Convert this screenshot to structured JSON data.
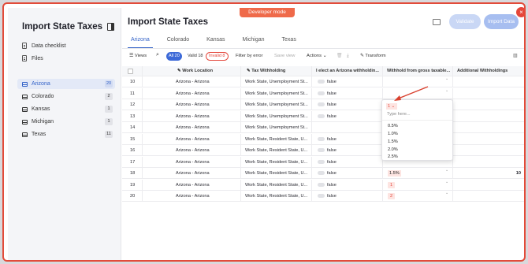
{
  "app": {
    "dev_banner": "Developer mode"
  },
  "sidebar": {
    "title": "Import State Taxes",
    "links": [
      "Data checklist",
      "Files"
    ],
    "sheets": [
      {
        "label": "Arizona",
        "count": "20",
        "active": true
      },
      {
        "label": "Colorado",
        "count": "2"
      },
      {
        "label": "Kansas",
        "count": "1"
      },
      {
        "label": "Michigan",
        "count": "1"
      },
      {
        "label": "Texas",
        "count": "11"
      }
    ]
  },
  "header": {
    "title": "Import State Taxes",
    "validate_label": "Validate",
    "import_label": "Import Data"
  },
  "tabs": [
    "Arizona",
    "Colorado",
    "Kansas",
    "Michigan",
    "Texas"
  ],
  "toolbar": {
    "views_label": "Views",
    "filter_all": "All 20",
    "filter_valid": "Valid 18",
    "filter_invalid": "Invalid 8",
    "filter_by_error": "Filter by error",
    "save_view": "Save view",
    "actions": "Actions",
    "transform": "Transform"
  },
  "table": {
    "columns": [
      "Work Location",
      "Tax Withholding",
      "I elect an Arizona withholdin...",
      "Withhold from gross taxable...",
      "Additional Withholdings"
    ],
    "rows": [
      {
        "n": "10",
        "loc": "Arizona - Arizona",
        "tax": "Work State, Unemployment St...",
        "elect": "false",
        "gross": "",
        "add": ""
      },
      {
        "n": "11",
        "loc": "Arizona - Arizona",
        "tax": "Work State, Unemployment St...",
        "elect": "false",
        "gross": "",
        "add": ""
      },
      {
        "n": "12",
        "loc": "Arizona - Arizona",
        "tax": "Work State, Unemployment St...",
        "elect": "false",
        "gross": "1",
        "add": ""
      },
      {
        "n": "13",
        "loc": "Arizona - Arizona",
        "tax": "Work State, Unemployment St...",
        "elect": "false",
        "gross": "",
        "add": ""
      },
      {
        "n": "14",
        "loc": "Arizona - Arizona",
        "tax": "Work State, Unemployment St...",
        "elect": "",
        "gross": "",
        "add": ""
      },
      {
        "n": "15",
        "loc": "Arizona - Arizona",
        "tax": "Work State, Resident State, U...",
        "elect": "false",
        "gross": "",
        "add": ""
      },
      {
        "n": "16",
        "loc": "Arizona - Arizona",
        "tax": "Work State, Resident State, U...",
        "elect": "false",
        "gross": "",
        "add": ""
      },
      {
        "n": "17",
        "loc": "Arizona - Arizona",
        "tax": "Work State, Resident State, U...",
        "elect": "false",
        "gross": "",
        "add": ""
      },
      {
        "n": "18",
        "loc": "Arizona - Arizona",
        "tax": "Work State, Resident State, U...",
        "elect": "false",
        "gross": "1.5%",
        "add": "10"
      },
      {
        "n": "19",
        "loc": "Arizona - Arizona",
        "tax": "Work State, Resident State, U...",
        "elect": "false",
        "gross": "1",
        "add": ""
      },
      {
        "n": "20",
        "loc": "Arizona - Arizona",
        "tax": "Work State, Resident State, U...",
        "elect": "false",
        "gross": "2",
        "add": ""
      }
    ]
  },
  "dropdown": {
    "selected": "1",
    "placeholder": "Type here...",
    "options": [
      "0.5%",
      "1.0%",
      "1.5%",
      "2.0%",
      "2.5%"
    ]
  }
}
